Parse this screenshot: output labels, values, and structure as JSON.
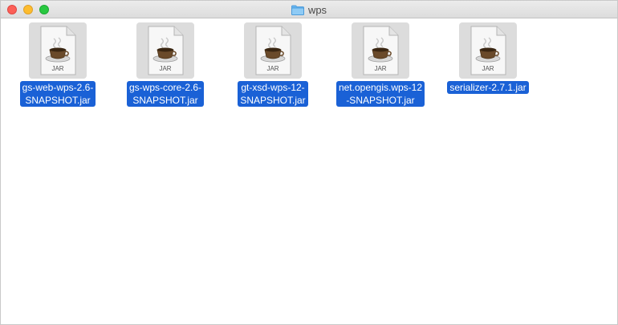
{
  "window": {
    "title": "wps",
    "folder_icon": "folder-icon"
  },
  "files": [
    {
      "name_line1": "gs-web-wps-2.6-",
      "name_line2": "SNAPSHOT.jar",
      "badge": "JAR",
      "icon": "jar-file-icon"
    },
    {
      "name_line1": "gs-wps-core-2.6-",
      "name_line2": "SNAPSHOT.jar",
      "badge": "JAR",
      "icon": "jar-file-icon"
    },
    {
      "name_line1": "gt-xsd-wps-12-",
      "name_line2": "SNAPSHOT.jar",
      "badge": "JAR",
      "icon": "jar-file-icon"
    },
    {
      "name_line1": "net.opengis.wps-12",
      "name_line2": "-SNAPSHOT.jar",
      "badge": "JAR",
      "icon": "jar-file-icon"
    },
    {
      "name_line1": "serializer-2.7.1.jar",
      "name_line2": "",
      "badge": "JAR",
      "icon": "jar-file-icon"
    }
  ],
  "colors": {
    "selection": "#1a61d6",
    "close": "#fc5f57",
    "minimize": "#fdbc2e",
    "maximize": "#28c840"
  }
}
